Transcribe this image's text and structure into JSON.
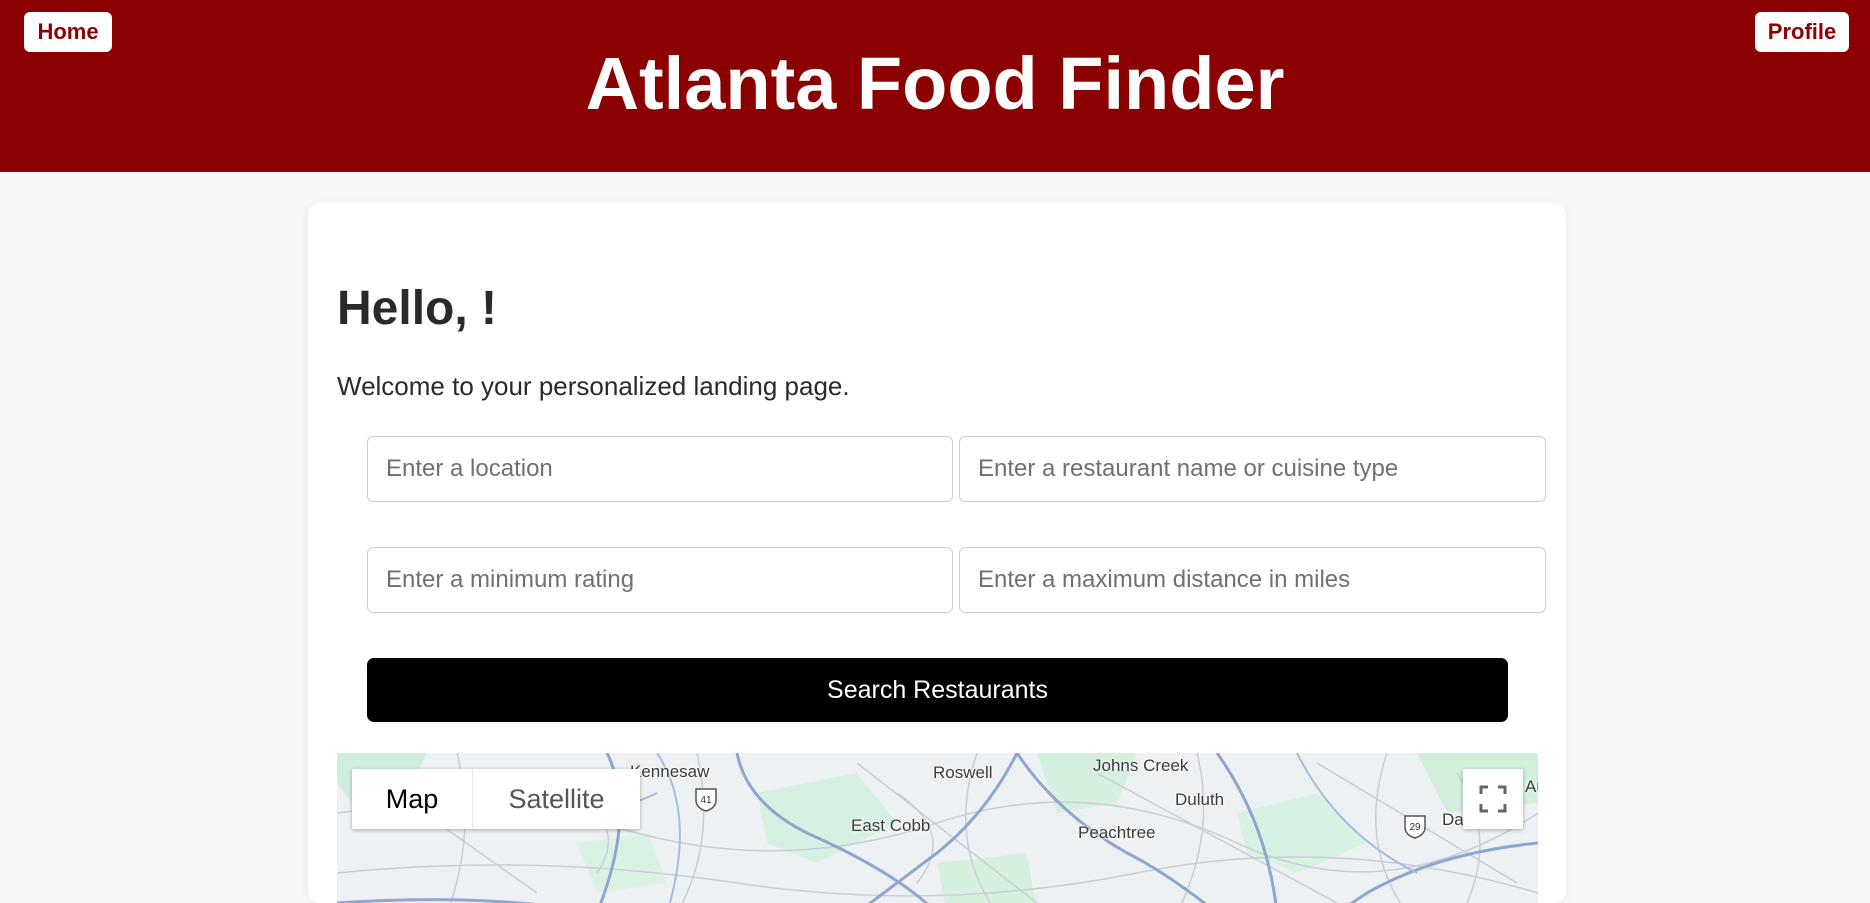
{
  "header": {
    "home_label": "Home",
    "profile_label": "Profile",
    "title": "Atlanta Food Finder",
    "bg_color": "#8b0000"
  },
  "main": {
    "greeting": "Hello, !",
    "welcome": "Welcome to your personalized landing page.",
    "inputs": {
      "location_placeholder": "Enter a location",
      "query_placeholder": "Enter a restaurant name or cuisine type",
      "rating_placeholder": "Enter a minimum rating",
      "distance_placeholder": "Enter a maximum distance in miles"
    },
    "search_button": "Search Restaurants"
  },
  "map": {
    "tabs": [
      "Map",
      "Satellite"
    ],
    "selected_tab": "Map",
    "places": [
      "Kennesaw",
      "Roswell",
      "Johns Creek",
      "Duluth",
      "East Cobb",
      "Peachtree",
      "Da",
      "Au"
    ],
    "shields": [
      "41",
      "29"
    ],
    "icons": [
      "fullscreen-icon"
    ]
  }
}
